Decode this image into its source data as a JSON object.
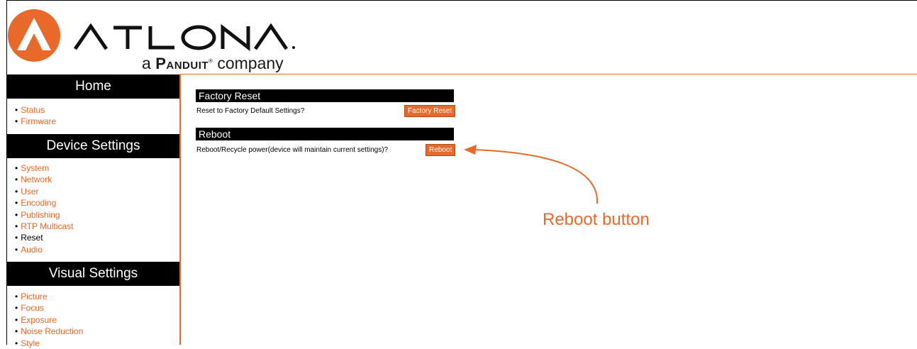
{
  "brand": {
    "name": "ATLONA",
    "tagline_prefix": "a",
    "tagline_brand": "Panduit",
    "tagline_suffix": "company",
    "accent_color": "#e8692a",
    "logo_icon": "atlona-logo-icon"
  },
  "sidebar": {
    "sections": [
      {
        "title": "Home",
        "items": [
          {
            "label": "Status",
            "current": false
          },
          {
            "label": "Firmware",
            "current": false
          }
        ]
      },
      {
        "title": "Device Settings",
        "items": [
          {
            "label": "System",
            "current": false
          },
          {
            "label": "Network",
            "current": false
          },
          {
            "label": "User",
            "current": false
          },
          {
            "label": "Encoding",
            "current": false
          },
          {
            "label": "Publishing",
            "current": false
          },
          {
            "label": "RTP Multicast",
            "current": false
          },
          {
            "label": "Reset",
            "current": true
          },
          {
            "label": "Audio",
            "current": false
          }
        ]
      },
      {
        "title": "Visual Settings",
        "items": [
          {
            "label": "Picture",
            "current": false
          },
          {
            "label": "Focus",
            "current": false
          },
          {
            "label": "Exposure",
            "current": false
          },
          {
            "label": "Noise Reduction",
            "current": false
          },
          {
            "label": "Style",
            "current": false
          }
        ]
      }
    ]
  },
  "main": {
    "factory_reset": {
      "title": "Factory Reset",
      "label": "Reset to Factory Default Settings?",
      "button": "Factory Reset"
    },
    "reboot": {
      "title": "Reboot",
      "label": "Reboot/Recycle power(device will maintain current settings)?",
      "button": "Reboot"
    }
  },
  "annotation": {
    "text": "Reboot button"
  }
}
